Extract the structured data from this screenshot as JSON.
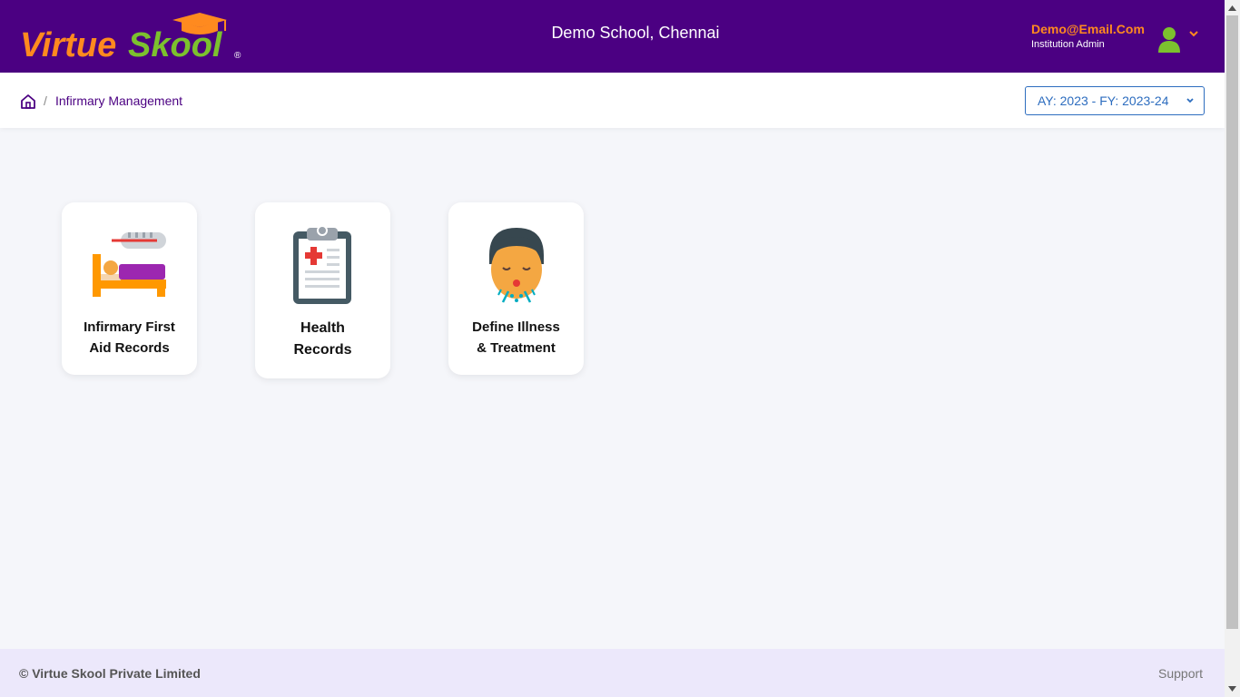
{
  "header": {
    "logo_text_virtue": "Virtue",
    "logo_text_skool": "Skool",
    "logo_reg": "®",
    "school_name": "Demo School, Chennai",
    "user_email": "Demo@Email.Com",
    "user_role": "Institution Admin",
    "colors": {
      "bar": "#4b0082",
      "virtue": "#ff8a1f",
      "skool": "#7cc12e"
    }
  },
  "breadcrumb": {
    "separator": "/",
    "current": "Infirmary Management"
  },
  "year_select": {
    "value": "AY: 2023 - FY: 2023-24"
  },
  "tiles": [
    {
      "label_line1": "Infirmary First",
      "label_line2": "Aid Records",
      "icon": "bed-thermometer-icon"
    },
    {
      "label_line1": "Health",
      "label_line2": "Records",
      "icon": "medical-clipboard-icon"
    },
    {
      "label_line1": "Define Illness",
      "label_line2": "& Treatment",
      "icon": "sick-face-icon"
    }
  ],
  "footer": {
    "copyright": "© Virtue Skool Private Limited",
    "support": "Support"
  }
}
